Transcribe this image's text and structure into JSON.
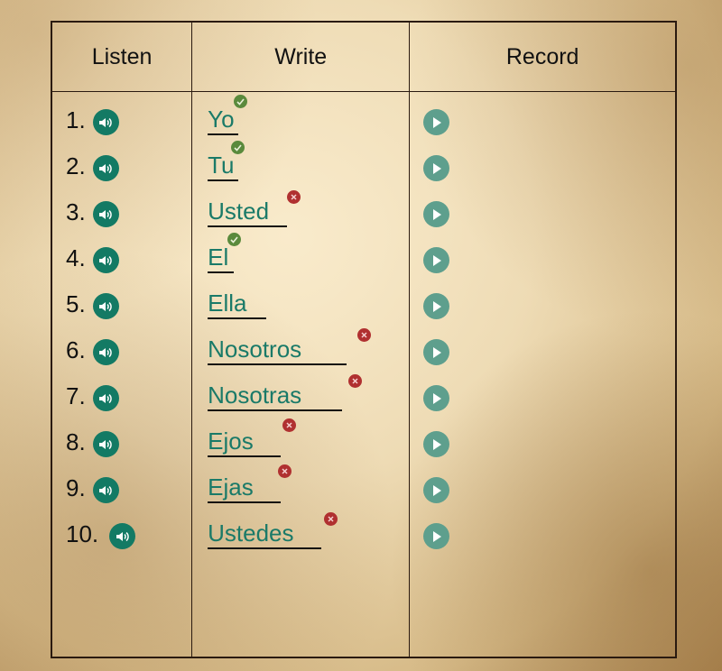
{
  "headers": {
    "listen": "Listen",
    "write": "Write",
    "record": "Record"
  },
  "colors": {
    "speaker": "#137a64",
    "play": "#5e9f8d",
    "word": "#1a7a68",
    "correct": "#5a8a3c",
    "incorrect": "#b03030"
  },
  "rows": [
    {
      "number": "1.",
      "word": "Yo",
      "status": "correct"
    },
    {
      "number": "2.",
      "word": "Tu",
      "status": "correct"
    },
    {
      "number": "3.",
      "word": "Usted",
      "status": "incorrect"
    },
    {
      "number": "4.",
      "word": "El",
      "status": "correct"
    },
    {
      "number": "5.",
      "word": "Ella",
      "status": "none"
    },
    {
      "number": "6.",
      "word": "Nosotros",
      "status": "incorrect"
    },
    {
      "number": "7.",
      "word": "Nosotras",
      "status": "incorrect"
    },
    {
      "number": "8.",
      "word": "Ejos",
      "status": "incorrect"
    },
    {
      "number": "9.",
      "word": "Ejas",
      "status": "incorrect"
    },
    {
      "number": "10.",
      "word": "Ustedes",
      "status": "incorrect"
    }
  ]
}
